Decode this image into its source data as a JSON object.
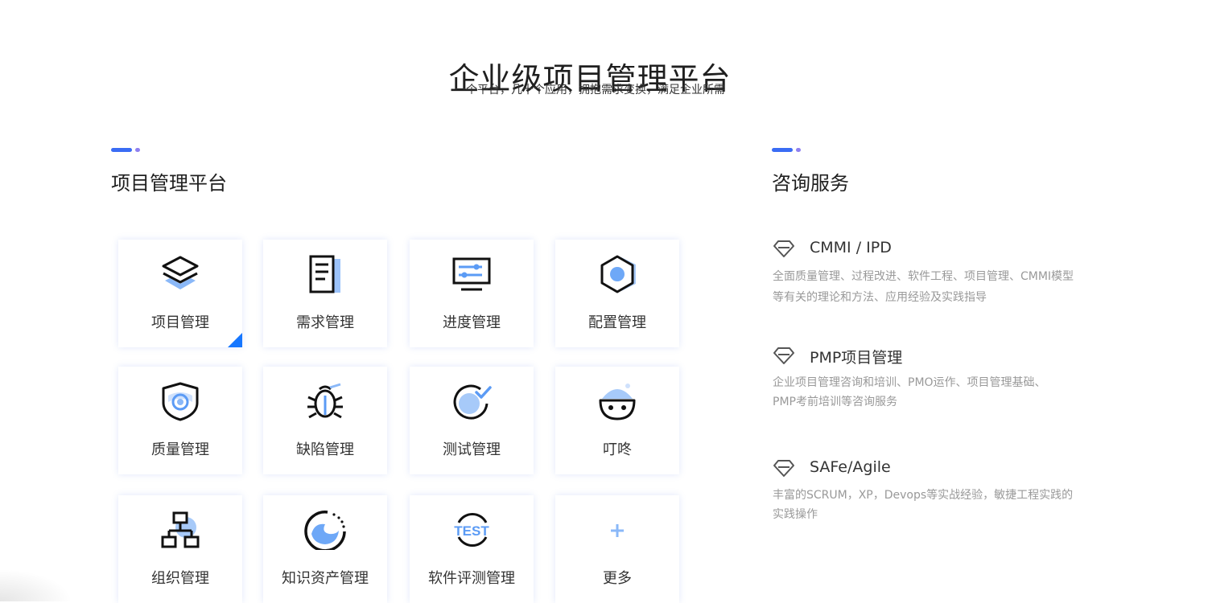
{
  "header": {
    "title": "企业级项目管理平台",
    "subtitle": "一个平台，几十个应用，拥抱需求变换，满足企业所需"
  },
  "platform": {
    "title": "项目管理平台",
    "tiles": [
      {
        "label": "项目管理",
        "icon": "layers-icon"
      },
      {
        "label": "需求管理",
        "icon": "document-icon"
      },
      {
        "label": "进度管理",
        "icon": "monitor-icon"
      },
      {
        "label": "配置管理",
        "icon": "hexagon-icon"
      },
      {
        "label": "质量管理",
        "icon": "shield-icon"
      },
      {
        "label": "缺陷管理",
        "icon": "bug-icon"
      },
      {
        "label": "测试管理",
        "icon": "check-circle-icon"
      },
      {
        "label": "叮咚",
        "icon": "chat-face-icon"
      },
      {
        "label": "组织管理",
        "icon": "org-chart-icon"
      },
      {
        "label": "知识资产管理",
        "icon": "knowledge-icon"
      },
      {
        "label": "软件评测管理",
        "icon": "test-icon"
      },
      {
        "label": "更多",
        "icon": "plus-icon"
      }
    ]
  },
  "consulting": {
    "title": "咨询服务",
    "items": [
      {
        "title": "CMMI / IPD",
        "desc_lines": [
          "全面质量管理、过程改进、软件工程、项目管理、CMMI模型",
          "等有关的理论和方法、应用经验及实践指导"
        ]
      },
      {
        "title": "PMP项目管理",
        "desc_lines": [
          "企业项目管理咨询和培训、PMO运作、项目管理基础、",
          "PMP考前培训等咨询服务"
        ]
      },
      {
        "title": "SAFe/Agile",
        "desc_lines": [
          "丰富的SCRUM，XP，Devops等实战经验，敏捷工程实践的",
          "实践操作"
        ]
      }
    ]
  },
  "colors": {
    "accent_blue": "#3a6cf4",
    "accent_purple": "#8f80f0",
    "icon_blue": "#5b9bf5",
    "corner_blue": "#1677ff"
  }
}
